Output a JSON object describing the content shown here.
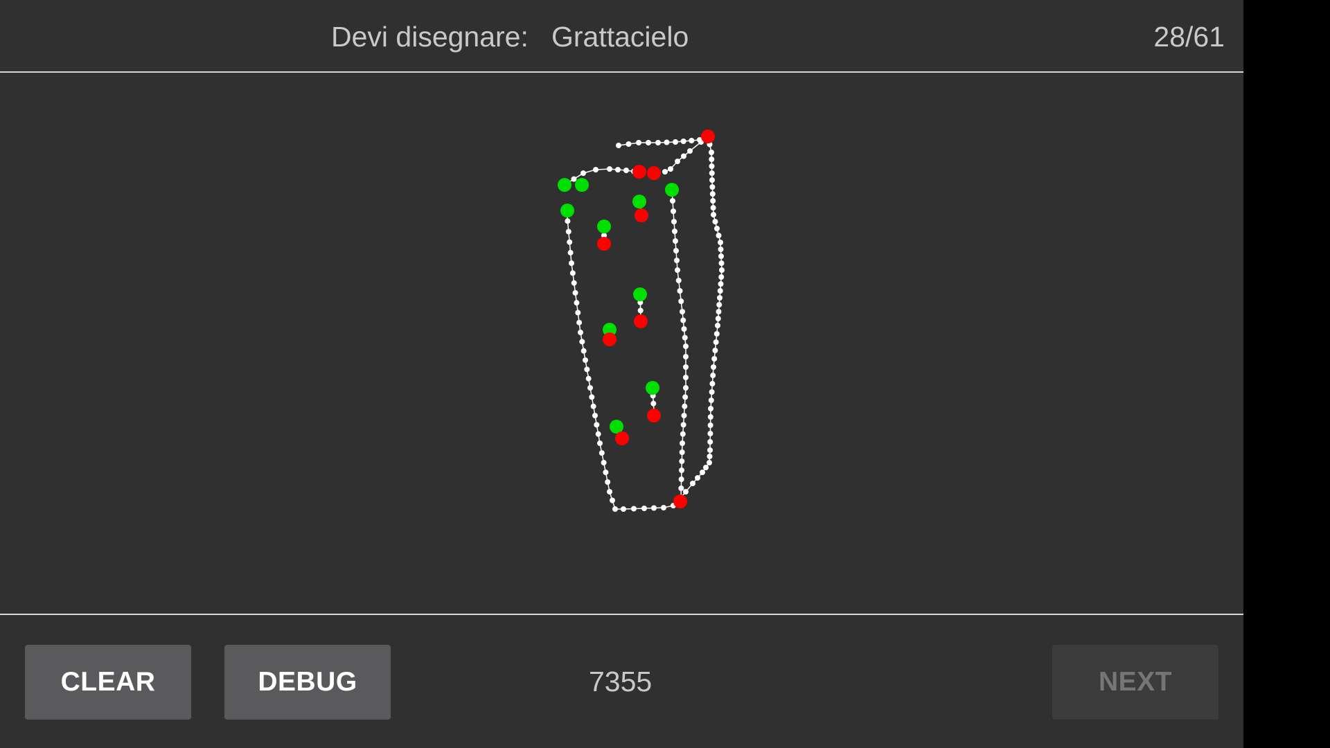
{
  "header": {
    "prompt_label": "Devi disegnare:",
    "prompt_word": "Grattacielo",
    "counter": "28/61"
  },
  "footer": {
    "clear_label": "CLEAR",
    "debug_label": "DEBUG",
    "score": "7355",
    "next_label": "NEXT"
  },
  "colors": {
    "background": "#303030",
    "stroke": "#ffffff",
    "start_point": "#00e000",
    "end_point": "#ff0000",
    "button_active": "#5a5a5c",
    "button_disabled": "#3b3b3b"
  }
}
